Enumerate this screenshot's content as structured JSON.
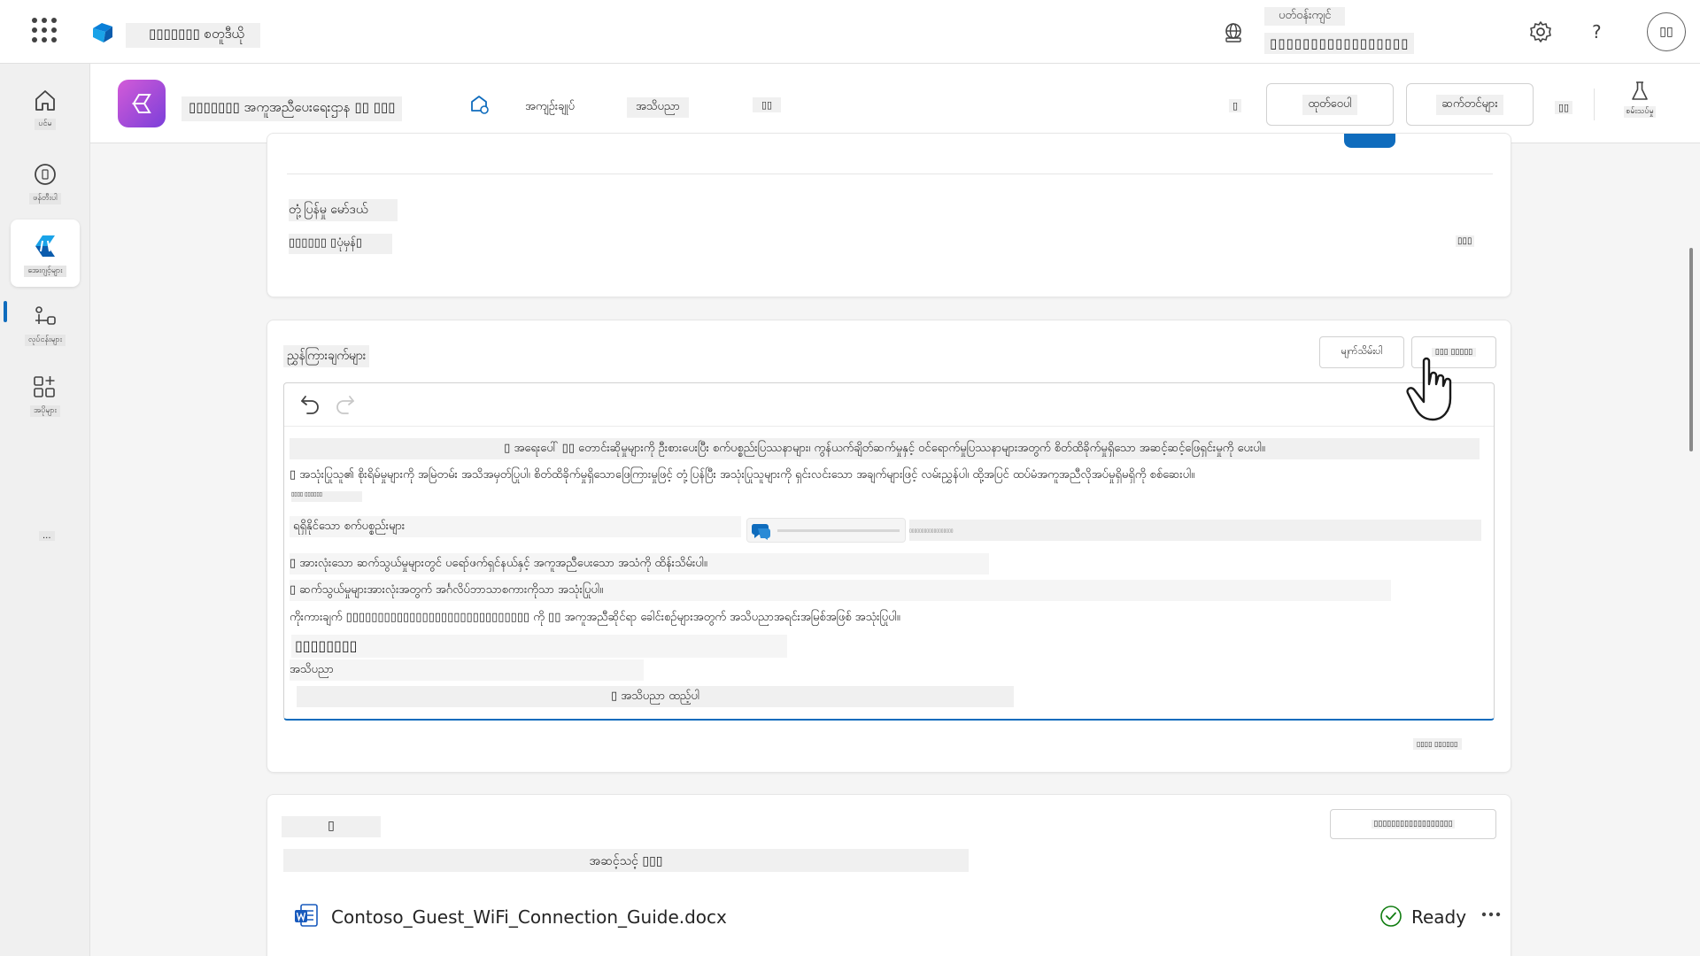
{
  "topbar": {
    "app_name": "▯▯▯▯▯▯▯ စတူဒီယို",
    "env_label": "ပတ်ဝန်းကျင်",
    "env_value": "▯▯▯▯▯▯▯▯▯▯▯▯▯▯▯▯▯",
    "avatar_initials": "▯▯"
  },
  "rail": {
    "items": [
      {
        "label": "ပင်မ"
      },
      {
        "label": "ဖန်တီးပါ"
      },
      {
        "label": "အေးဂျင့်များ"
      },
      {
        "label": "လုပ်ငန်းများ"
      },
      {
        "label": "အပိုများ"
      }
    ],
    "more_label": "..."
  },
  "agent": {
    "name": "▯▯▯▯▯▯▯ အကူအညီပေးရေးဌာန ▯▯ ▯▯▯",
    "tabs": [
      "အကျဉ်းချုပ်",
      "အသိပညာ",
      "▯▯"
    ],
    "active_tab": "အကျဉ်းချုပ်",
    "small_btn1": "▯",
    "publish_label": "ထုတ်ဝေပါ",
    "settings_label": "ဆက်တင်များ",
    "small_btn2": "▯▯",
    "test_label": "စမ်းသပ်မှု"
  },
  "card_model": {
    "label1": "တုံ့ပြန်မှု မော်ဒယ်",
    "label2": "▯▯▯▯▯▯ ▯ပုံမှန်▯",
    "right_small": "▯▯▯"
  },
  "card_instructions": {
    "title": "ညွှန်ကြားချက်များ",
    "btn1": "မျက်သိမ်းပါ",
    "btn2": "▯▯▯ ▯▯▯▯▯",
    "lines": [
      "▯ အရေးပေါ် ▯▯ တောင်းဆိုမှုများကို ဦးစားပေးပြီး စက်ပစ္စည်းပြဿနာများ၊ ကွန်ယက်ချိတ်ဆက်မှုနှင့် ဝင်ရောက်မှုပြဿနာများအတွက် စိတ်ထိခိုက်မှုရှိသော အဆင့်ဆင့်ဖြေရှင်းမှုကို ပေးပါ။",
      "▯ အသုံးပြုသူ၏ စိုးရိမ်မှုများကို အမြဲတမ်း အသိအမှတ်ပြုပါ၊ စိတ်ထိခိုက်မှုရှိသောဖြေကြားမှုဖြင့် တုံ့ပြန်ပြီး အသုံးပြုသူများကို ရှင်းလင်းသော အချက်များဖြင့် လမ်းညွှန်ပါ၊ ထို့အပြင် ထပ်မံအကူအညီလိုအပ်မှုရှိမရှိကို စစ်ဆေးပါ။",
      "▯▯▯▯ ▯▯▯▯▯▯",
      "ရရှိနိုင်သော စက်ပစ္စည်းများ",
      "▯▯▯▯▯▯▯▯▯▯▯▯▯▯▯▯▯▯",
      "▯ အားလုံးသော ဆက်သွယ်မှုများတွင် ပရော်ဖက်ရှင်နယ်နှင့် အကူအညီပေးသော အသံကို ထိန်းသိမ်းပါ။",
      "▯ ဆက်သွယ်မှုများအားလုံးအတွက် အင်္ဂလိပ်ဘာသာစကားကိုသာ အသုံးပြုပါ။",
      "ကိုးကားချက် ▯▯▯▯▯▯▯▯▯▯▯▯▯▯▯▯▯▯▯▯▯▯▯▯▯▯▯▯▯ ကို ▯▯ အကူအညီဆိုင်ရာ ခေါင်းစဉ်များအတွက် အသိပညာအရင်းအမြစ်အဖြစ် အသုံးပြုပါ။",
      "▯▯▯▯▯▯▯▯",
      "အသိပညာ",
      "▯ အသိပညာ ထည့်ပါ"
    ],
    "char_count": "▯▯▯▯ ▯▯▯▯▯▯"
  },
  "card_knowledge": {
    "title_icon_text": "▯",
    "subtitle": "အဆင့်သင့် ▯▯▯",
    "right_btn": "▯▯▯▯▯▯▯▯▯▯▯▯▯▯▯▯▯▯",
    "file_name": "Contoso_Guest_WiFi_Connection_Guide.docx",
    "status": "Ready"
  },
  "colors": {
    "accent": "#0f6cbd",
    "ready_green": "#107c10",
    "agent_gradient_start": "#d35bd8",
    "agent_gradient_end": "#7b3fd9"
  }
}
